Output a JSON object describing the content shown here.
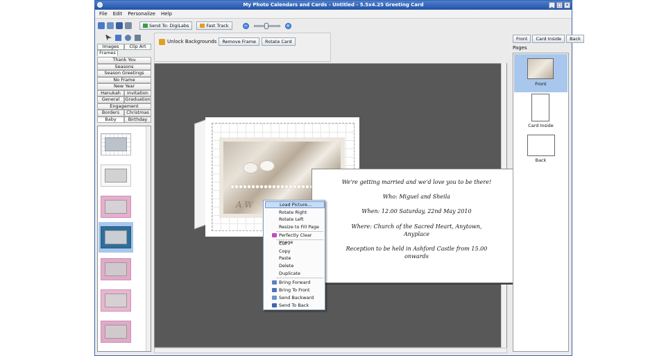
{
  "window": {
    "title": "My Photo Calendars and Cards - Untitled - 5.5x4.25 Greeting Card",
    "controls": [
      "_",
      "□",
      "✕"
    ]
  },
  "menu": [
    "File",
    "Edit",
    "Personalize",
    "Help"
  ],
  "toolbar": {
    "send_label": "Send To: DigiLabs",
    "fasttrack_label": "Fast Track",
    "zoom_level": 0.45
  },
  "left": {
    "tabs": [
      "Images",
      "Clip Art",
      "Frames"
    ],
    "active_tab": "Frames",
    "categories": [
      "Thank You",
      "Seasons",
      "Season Greetings",
      "No Frame",
      "New Year"
    ],
    "category_pairs": [
      [
        "Hanukah",
        "Invitation"
      ],
      [
        "General",
        "Graduation"
      ]
    ],
    "engagement": "Engagement",
    "category_pairs2": [
      [
        "Borders",
        "Christmas"
      ],
      [
        "Baby",
        "Birthday"
      ]
    ]
  },
  "framebar": {
    "unlock_label": "Unlock Backgrounds",
    "remove_frame": "Remove Frame",
    "rotate_card": "Rotate Card"
  },
  "invite": {
    "line1": "We're getting married and we'd love you to be there!",
    "line2": "Who: Miguel and Sheila",
    "line3": "When: 12.00 Saturday, 22nd May 2010",
    "line4a": "Where: Church of the Sacred Heart, Anytown,",
    "line4b": "Anyplace",
    "line5a": "Reception to be held in Ashford Castle from 15.00",
    "line5b": "onwards"
  },
  "context_menu": {
    "load": "Load Picture...",
    "rotate_right": "Rotate Right",
    "rotate_left": "Rotate Left",
    "resize": "Resize to Fill Page",
    "perfectly": "Perfectly Clear Image",
    "cut": "Cut",
    "copy": "Copy",
    "paste": "Paste",
    "delete": "Delete",
    "duplicate": "Duplicate",
    "bring_forward": "Bring Forward",
    "bring_front": "Bring To Front",
    "send_backward": "Send Backward",
    "send_back": "Send To Back"
  },
  "right": {
    "front_btn": "Front",
    "inside_btn": "Card Inside",
    "back_btn": "Back",
    "pages_label": "Pages",
    "pages": [
      "Front",
      "Card Inside",
      "Back"
    ]
  },
  "colors": {
    "canvas": "#585858",
    "selection": "#a9c7ec",
    "titlebar": "#2352a4"
  }
}
